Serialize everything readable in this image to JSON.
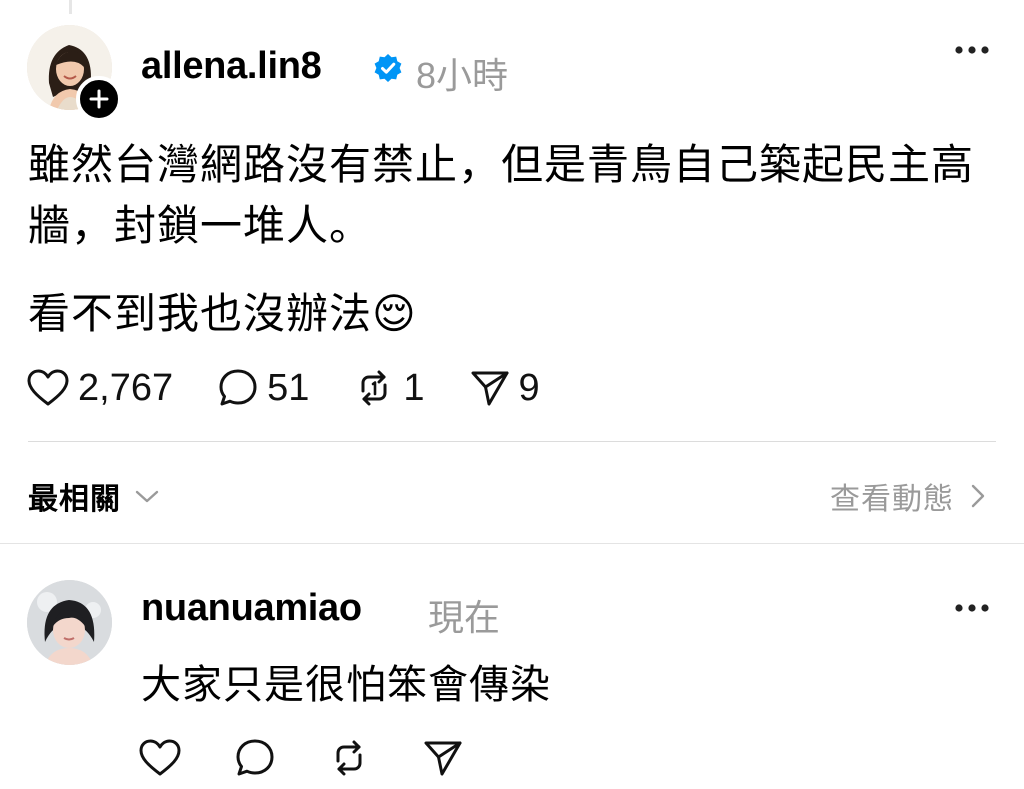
{
  "post": {
    "username": "allena.lin8",
    "timestamp": "8小時",
    "text_p1": "雖然台灣網路沒有禁止，但是青鳥自己築起民主高牆，封鎖一堆人。",
    "text_p2": "看不到我也沒辦法😌",
    "likes": "2,767",
    "comments": "51",
    "reposts": "1",
    "shares": "9"
  },
  "replies_header": {
    "sort_label": "最相關",
    "view_activity_label": "查看動態"
  },
  "reply": {
    "username": "nuanuamiao",
    "timestamp": "現在",
    "text": "大家只是很怕笨會傳染"
  },
  "colors": {
    "verified_blue": "#0095f6",
    "secondary_text": "#9a9a9a",
    "divider": "#dcdcdc"
  },
  "icons": {
    "like": "heart-icon",
    "comment": "comment-bubble-icon",
    "repost": "repost-icon",
    "share": "send-icon",
    "verified": "verified-badge-icon",
    "follow": "plus-icon",
    "more": "more-options-icon"
  }
}
